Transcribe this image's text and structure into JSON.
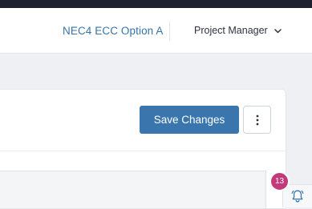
{
  "header": {
    "contract_type": "NEC4 ECC Option A",
    "role_menu": {
      "label": "Project Manager",
      "icon": "chevron-down-icon"
    }
  },
  "toolbar": {
    "save_label": "Save Changes",
    "more_icon": "kebab-vertical-icon"
  },
  "notifications": {
    "count": "13",
    "icon": "bell-icon"
  },
  "colors": {
    "accent": "#3a76ad",
    "link": "#3574a8",
    "badge": "#c23a7a",
    "topbar": "#1f2130"
  }
}
